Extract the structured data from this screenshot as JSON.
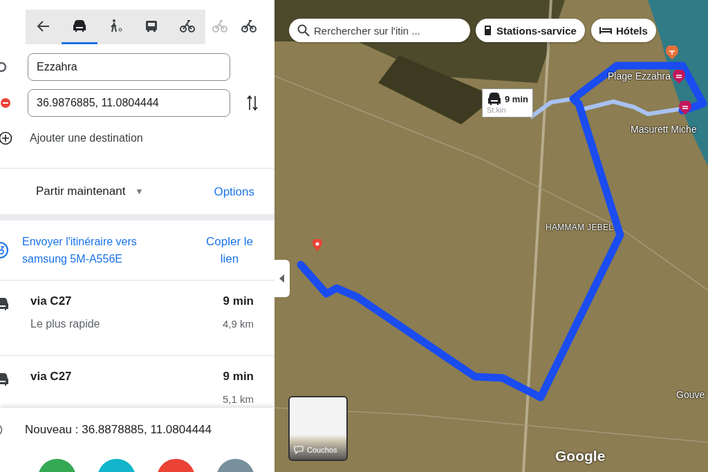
{
  "travel_modes": [
    {
      "kind": "back",
      "selected": false,
      "disabled": false
    },
    {
      "kind": "car",
      "selected": true,
      "disabled": false
    },
    {
      "kind": "walk",
      "selected": false,
      "disabled": false
    },
    {
      "kind": "transit",
      "selected": false,
      "disabled": false
    },
    {
      "kind": "bike",
      "selected": false,
      "disabled": false
    },
    {
      "kind": "bike",
      "selected": false,
      "disabled": true
    },
    {
      "kind": "bike",
      "selected": false,
      "disabled": false
    }
  ],
  "origin": {
    "value": "Ezzahra"
  },
  "destination": {
    "value": "36.9876885, 11.0804444"
  },
  "add_destination": "Ajouter une destination",
  "departure": {
    "label": "Partir maintenant",
    "caret": "▼",
    "options": "Options"
  },
  "send": {
    "label": "Envoyer l'itinéraire vers samsung 5M-A556E",
    "copy_link": "Copler le lien"
  },
  "routes": [
    {
      "name": "via C27",
      "duration": "9 min",
      "note": "Le plus rapide",
      "distance": "4,9 km"
    },
    {
      "name": "via C27",
      "duration": "9 min",
      "distance": "5,1 km"
    }
  ],
  "new_point": "Nouveau : 36.8878885, 11.0804444",
  "actions": [
    {
      "color": "#34a853"
    },
    {
      "color": "#12b5cb"
    },
    {
      "color": "#ea4335"
    },
    {
      "color": "#78909c"
    }
  ],
  "map": {
    "search": {
      "placeholder": "Rerchercher sur l'itin ..."
    },
    "chips": [
      {
        "kind": "fuel",
        "label": "Stations-sarvice"
      },
      {
        "kind": "hotel",
        "label": "Hótels"
      }
    ],
    "route_tooltip": {
      "duration": "9 min",
      "detail": "St.kin"
    },
    "places": [
      {
        "label": "Plage Ezzahra",
        "kind": "name"
      },
      {
        "label": "Masurett Miche",
        "kind": "name"
      },
      {
        "label": "HAMMAM JEBEL",
        "kind": "town"
      },
      {
        "label": "Gouve",
        "kind": "name"
      }
    ],
    "thumbnail": {
      "label": "Couchos"
    },
    "logo": "Google"
  }
}
